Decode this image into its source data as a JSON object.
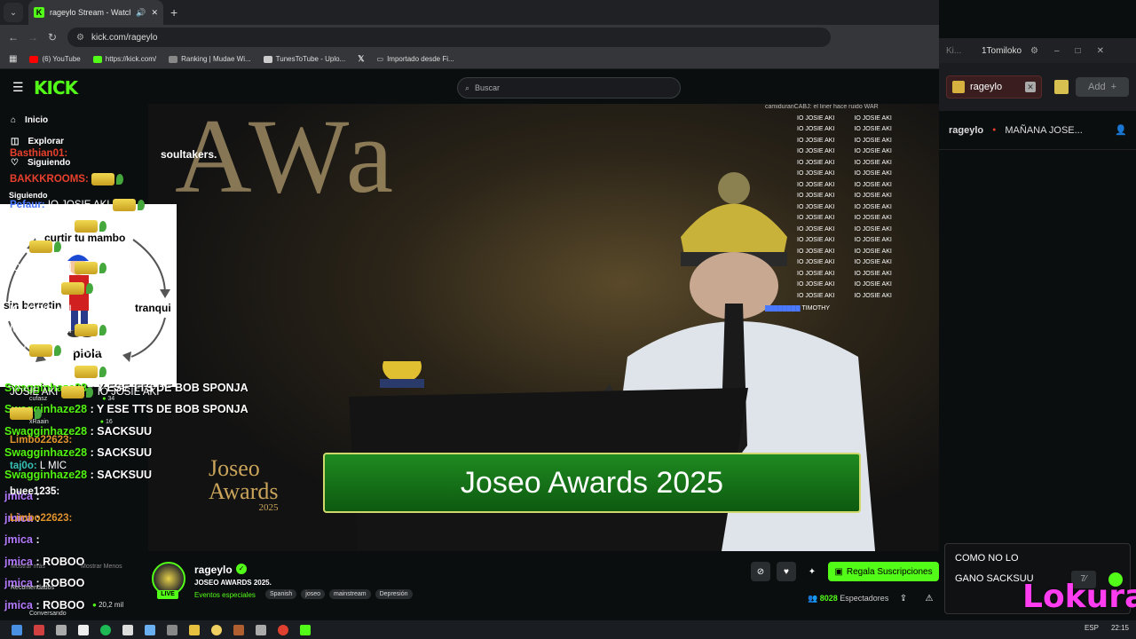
{
  "browser": {
    "tab_title": "rageylo Stream - Watch Liv",
    "url": "kick.com/rageylo",
    "bookmarks": [
      "(6) YouTube",
      "https://kick.com/",
      "Ranking | Mudae Wi...",
      "TunesToTube - Uplo...",
      "",
      "Importado desde Fi..."
    ]
  },
  "header": {
    "logo": "KICK",
    "search_placeholder": "Buscar"
  },
  "sidebar": {
    "items": [
      "Inicio",
      "Explorar",
      "Siguiendo"
    ],
    "section": "Siguiendo"
  },
  "overlay_card": {
    "top": "curtir tu mambo",
    "left": "sin berretin",
    "right": "tranqui",
    "bottom": "piola"
  },
  "video": {
    "brand": "soultakers.",
    "banner": "Joseo Awards 2025",
    "logo_line1": "Joseo",
    "logo_line2": "Awards",
    "logo_year": "2025",
    "overlay_chat_top": "camiduranCABJ: el liner hace ruido WAR",
    "overlay_chat_repeat": "IO JOSIE AKI",
    "overlay_chat_bottom": "TIMOTHY"
  },
  "leftchat": {
    "lines": [
      {
        "user": "Swagginhaze28",
        "text": " : Y ESE TTS DE BOB SPONJA"
      },
      {
        "user": "Swagginhaze28",
        "text": " : Y ESE TTS DE BOB SPONJA"
      },
      {
        "user": "Swagginhaze28",
        "text": " : SACKSUU"
      },
      {
        "user": "Swagginhaze28",
        "text": " : SACKSUU"
      },
      {
        "user": "Swagginhaze28",
        "text": " : SACKSUU"
      },
      {
        "user": "jmica",
        "text": " :"
      },
      {
        "user": "jmica",
        "text": " :"
      },
      {
        "user": "jmica",
        "text": " :"
      },
      {
        "user": "jmica",
        "text": " : ROBOO"
      },
      {
        "user": "jmica",
        "text": " : ROBOO"
      },
      {
        "user": "jmica",
        "text": " : ROBOO"
      },
      {
        "user": "jmica",
        "text": " : ROBOO"
      }
    ],
    "meta": {
      "cufasz": "cufasz",
      "cufasz_count": "34",
      "xraain": "xRaain",
      "xraain_count": "16",
      "mostrar_mas": "Mostrar más",
      "mostrar_menos": "Mostrar Menos",
      "recomendados": "Recomendados",
      "conversando": "Conversando",
      "count": "20,2 mil"
    }
  },
  "stream": {
    "channel": "rageylo",
    "live": "LIVE",
    "title": "JOSEO AWARDS 2025.",
    "category": "Eventos especiales",
    "tags": [
      "Spanish",
      "joseo",
      "mainstream",
      "Depresión"
    ],
    "subscribe": "Regala Suscripciones",
    "viewers": "8028",
    "viewers_label": "Espectadores"
  },
  "extension": {
    "account": "1Tomiloko",
    "chip": "rageylo",
    "add": "Add"
  },
  "chat": {
    "channel": "rageylo",
    "pinned": "MAÑANA JOSE...",
    "messages": [
      {
        "user": "Basthian01:",
        "text": ""
      },
      {
        "user": "BAKKKROOMS:",
        "text": ""
      },
      {
        "user": "Pefaur:",
        "text": " IO JOSIE AKI"
      },
      {
        "user": "",
        "text": "IO JOSIE AKI"
      },
      {
        "user": "Limbo22623:",
        "text": ""
      },
      {
        "user": "taj0o:",
        "text": " L MIC"
      },
      {
        "user": "buee1235:",
        "text": ""
      },
      {
        "user": "Limbo22623:",
        "text": ""
      }
    ],
    "spam_rows": [
      "IO JOSIE AKI | IO JOSIE",
      "AKI | IO JOSIE AKI",
      "IO JOSIE AKI | IO",
      "JOSIE AKI | IO JOSIE AKI",
      "IO JOSIE AKI",
      "IO JOSIE AKI | IO JOSIE",
      "AKI | IO JOSIE AKI",
      "IO JOSIE AKI | IO",
      "JOSIE AKI | IO JOSIE AKI"
    ],
    "input_line1": "COMO NO LO",
    "input_line2": "GANO SACKSUU",
    "watermark": "Lokura"
  },
  "taskbar": {
    "lang": "ESP",
    "time": "22:15"
  }
}
